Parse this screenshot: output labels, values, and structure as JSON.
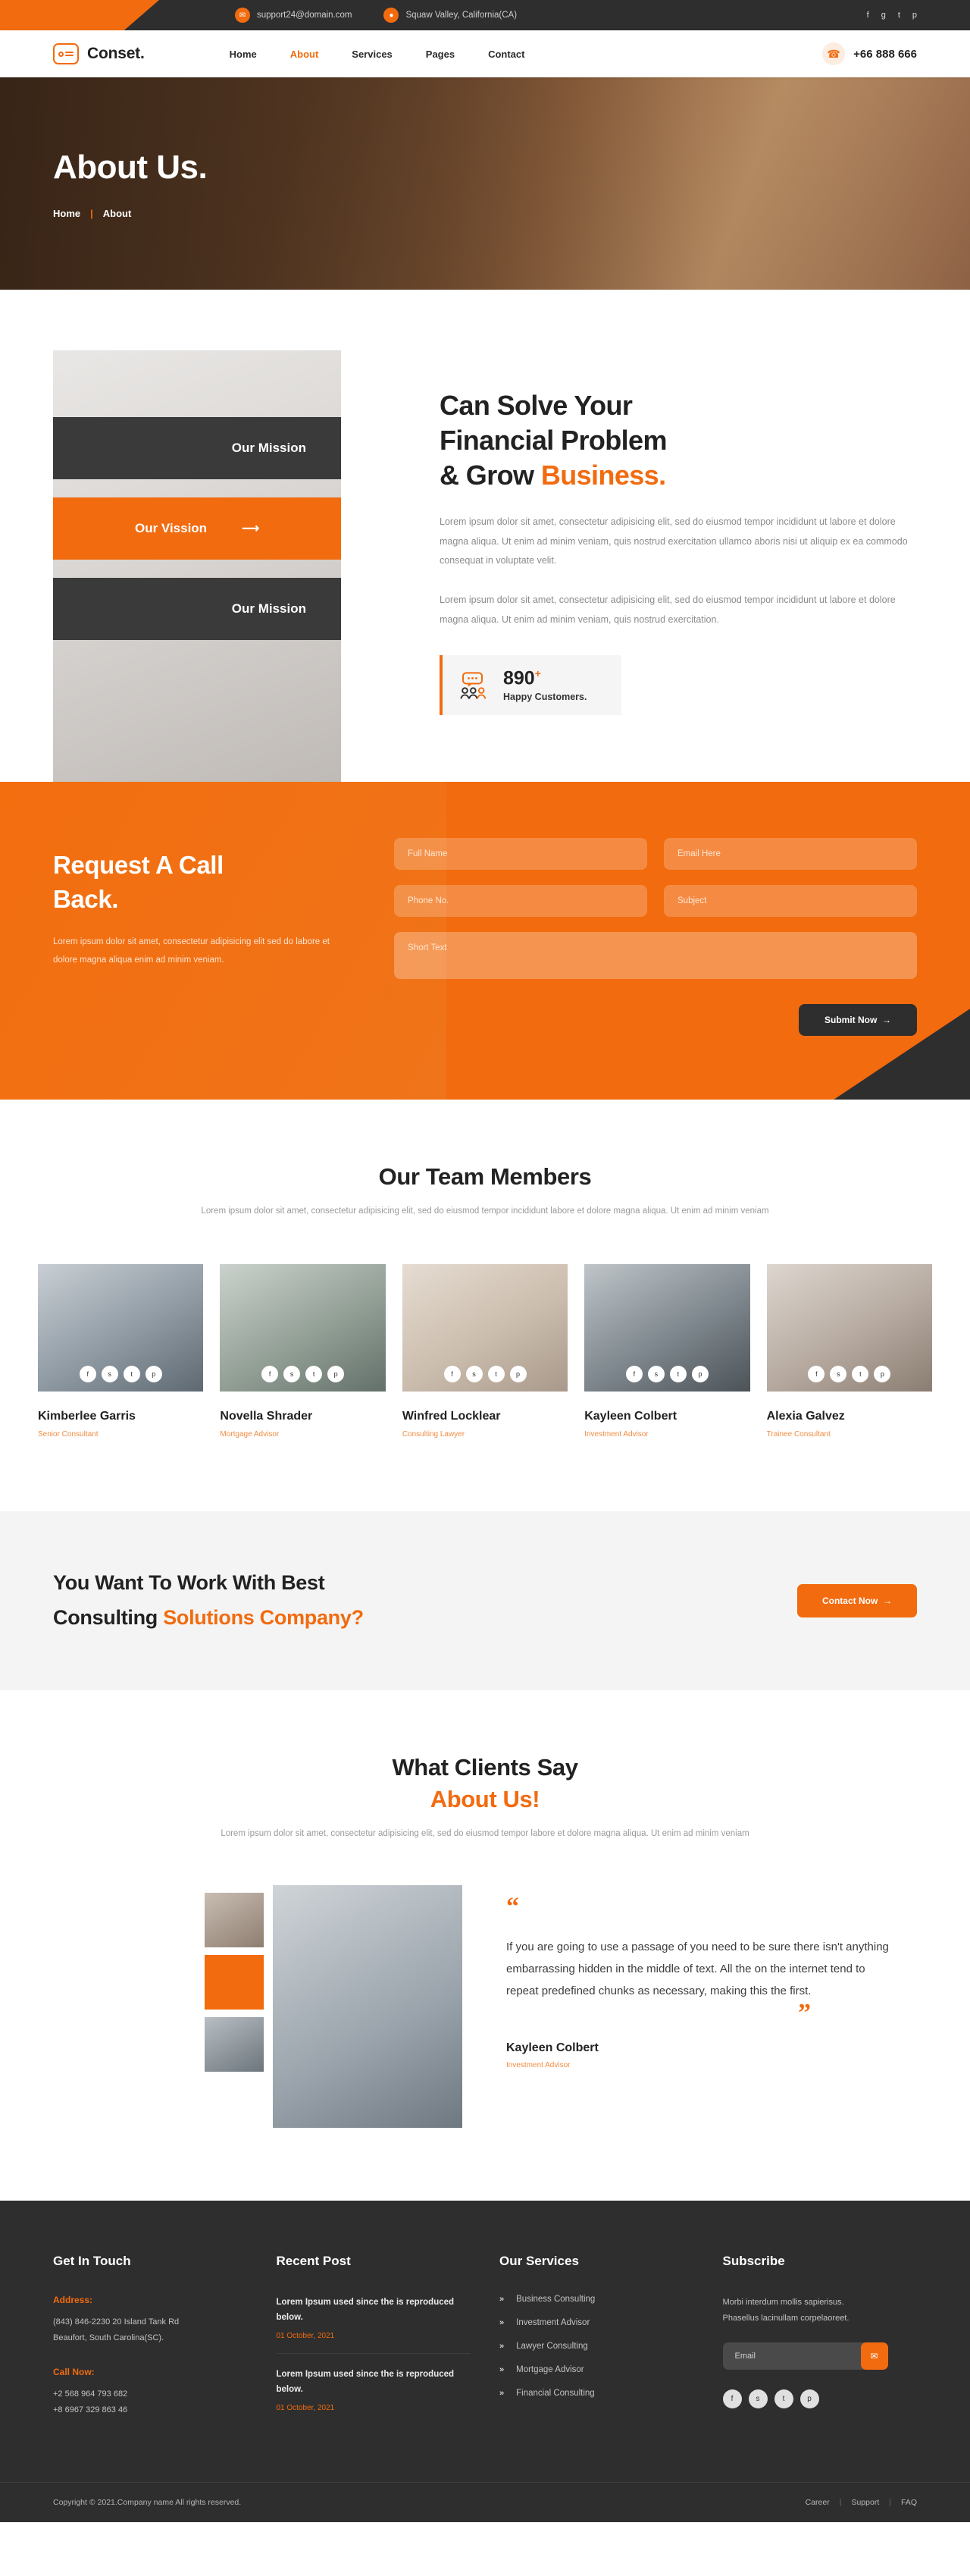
{
  "topbar": {
    "email": "support24@domain.com",
    "location": "Squaw Valley, California(CA)",
    "socials": [
      "f",
      "g",
      "t",
      "p"
    ]
  },
  "nav": {
    "brand": "Conset.",
    "menu": [
      {
        "label": "Home",
        "active": false
      },
      {
        "label": "About",
        "active": true
      },
      {
        "label": "Services",
        "active": false
      },
      {
        "label": "Pages",
        "active": false
      },
      {
        "label": "Contact",
        "active": false
      }
    ],
    "phone": "+66 888 666"
  },
  "hero": {
    "title": "About Us.",
    "crumb_home": "Home",
    "crumb_sep": "|",
    "crumb_current": "About"
  },
  "mission": {
    "tabs": [
      {
        "label": "Our Mission",
        "active": false
      },
      {
        "label": "Our Vission",
        "active": true
      },
      {
        "label": "Our Mission",
        "active": false
      }
    ],
    "heading_line1": "Can Solve Your",
    "heading_line2": "Financial Problem",
    "heading_line3_plain": "& Grow ",
    "heading_line3_hl": "Business.",
    "paragraph1": "Lorem ipsum dolor sit amet, consectetur adipisicing elit, sed do eiusmod tempor incididunt ut labore et dolore magna aliqua. Ut enim ad minim veniam, quis nostrud exercitation ullamco aboris nisi ut aliquip ex ea commodo consequat in voluptate velit.",
    "paragraph2": "Lorem ipsum dolor sit amet, consectetur adipisicing elit, sed do eiusmod tempor incididunt ut labore et dolore magna aliqua. Ut enim ad minim veniam, quis nostrud exercitation.",
    "stat_number": "890",
    "stat_sup": "+",
    "stat_label": "Happy Customers."
  },
  "callback": {
    "heading_line1": "Request A Call",
    "heading_line2": "Back.",
    "paragraph": "Lorem ipsum dolor sit amet, consectetur adipisicing elit sed do labore et dolore magna aliqua enim ad minim veniam.",
    "field_fullname": "Full Name",
    "field_email": "Email Here",
    "field_phone": "Phone No.",
    "field_subject": "Subject",
    "field_shorttext": "Short Text",
    "submit_label": "Submit Now"
  },
  "team": {
    "title": "Our Team Members",
    "subtitle": "Lorem ipsum dolor sit amet, consectetur adipisicing elit, sed do eiusmod tempor incididunt labore et dolore magna aliqua. Ut enim ad minim veniam",
    "members": [
      {
        "name": "Kimberlee Garris",
        "role": "Senior Consultant"
      },
      {
        "name": "Novella Shrader",
        "role": "Mortgage Advisor"
      },
      {
        "name": "Winfred Locklear",
        "role": "Consulting Lawyer"
      },
      {
        "name": "Kayleen Colbert",
        "role": "Investment Advisor"
      },
      {
        "name": "Alexia Galvez",
        "role": "Trainee Consultant"
      }
    ],
    "social_icons": [
      "f",
      "s",
      "t",
      "p"
    ]
  },
  "cta": {
    "line1": "You Want To Work With Best",
    "line2_plain": "Consulting ",
    "line2_hl": "Solutions Company?",
    "button": "Contact Now"
  },
  "testimonial": {
    "title_line1": "What Clients Say",
    "title_line2": "About Us!",
    "subtitle": "Lorem ipsum dolor sit amet, consectetur adipisicing elit, sed do eiusmod tempor labore et dolore magna aliqua. Ut enim ad minim veniam",
    "quote_open": "“",
    "quote": "If you are going to use a passage of you need to be sure there isn't anything embarrassing hidden in the middle of text. All the on the internet tend to repeat predefined chunks as necessary, making this the first.",
    "quote_close": "”",
    "author": "Kayleen Colbert",
    "author_role": "Investment Advisor"
  },
  "footer": {
    "get_in_touch": {
      "title": "Get In Touch",
      "address_label": "Address:",
      "address_line1": "(843) 846-2230 20 Island Tank Rd",
      "address_line2": "Beaufort, South Carolina(SC).",
      "call_label": "Call Now:",
      "phone1": "+2 568 964 793 682",
      "phone2": "+8 6967 329 863 46"
    },
    "recent_post": {
      "title": "Recent Post",
      "posts": [
        {
          "text": "Lorem Ipsum used since the is reproduced below.",
          "date": "01 October, 2021"
        },
        {
          "text": "Lorem Ipsum used since the is reproduced below.",
          "date": "01 October, 2021"
        }
      ]
    },
    "services": {
      "title": "Our Services",
      "items": [
        "Business Consulting",
        "Investment Advisor",
        "Lawyer Consulting",
        "Mortgage Advisor",
        "Financial Consulting"
      ]
    },
    "subscribe": {
      "title": "Subscribe",
      "text_line1": "Morbi interdum mollis sapierisus.",
      "text_line2": "Phasellus lacinullam corpelaoreet.",
      "email_placeholder": "Email",
      "socials": [
        "f",
        "s",
        "t",
        "p"
      ]
    },
    "copyright": "Copyright © 2021.Company name All rights reserved.",
    "links": [
      "Career",
      "Support",
      "FAQ"
    ]
  },
  "colors": {
    "accent": "#f26b0f",
    "dark": "#2e2e2e",
    "tab_dark": "#3a3a3a"
  }
}
